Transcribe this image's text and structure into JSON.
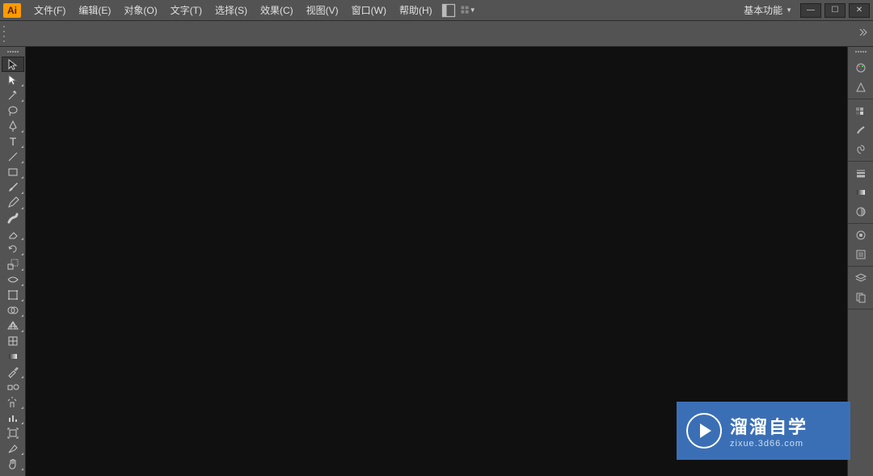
{
  "app": {
    "logo": "Ai"
  },
  "menu": {
    "file": "文件(F)",
    "edit": "编辑(E)",
    "object": "对象(O)",
    "type": "文字(T)",
    "select": "选择(S)",
    "effect": "效果(C)",
    "view": "视图(V)",
    "window": "窗口(W)",
    "help": "帮助(H)"
  },
  "workspace": {
    "label": "基本功能"
  },
  "window_controls": {
    "minimize": "—",
    "maximize": "☐",
    "close": "✕"
  },
  "tools": [
    {
      "name": "selection-tool",
      "selected": true,
      "flyout": false
    },
    {
      "name": "direct-selection-tool",
      "selected": false,
      "flyout": true
    },
    {
      "name": "magic-wand-tool",
      "selected": false,
      "flyout": true
    },
    {
      "name": "lasso-tool",
      "selected": false,
      "flyout": false
    },
    {
      "name": "pen-tool",
      "selected": false,
      "flyout": true
    },
    {
      "name": "type-tool",
      "selected": false,
      "flyout": true
    },
    {
      "name": "line-segment-tool",
      "selected": false,
      "flyout": true
    },
    {
      "name": "rectangle-tool",
      "selected": false,
      "flyout": true
    },
    {
      "name": "paintbrush-tool",
      "selected": false,
      "flyout": true
    },
    {
      "name": "pencil-tool",
      "selected": false,
      "flyout": true
    },
    {
      "name": "blob-brush-tool",
      "selected": false,
      "flyout": false
    },
    {
      "name": "eraser-tool",
      "selected": false,
      "flyout": true
    },
    {
      "name": "rotate-tool",
      "selected": false,
      "flyout": true
    },
    {
      "name": "scale-tool",
      "selected": false,
      "flyout": true
    },
    {
      "name": "width-tool",
      "selected": false,
      "flyout": true
    },
    {
      "name": "free-transform-tool",
      "selected": false,
      "flyout": true
    },
    {
      "name": "shape-builder-tool",
      "selected": false,
      "flyout": true
    },
    {
      "name": "perspective-grid-tool",
      "selected": false,
      "flyout": true
    },
    {
      "name": "mesh-tool",
      "selected": false,
      "flyout": false
    },
    {
      "name": "gradient-tool",
      "selected": false,
      "flyout": false
    },
    {
      "name": "eyedropper-tool",
      "selected": false,
      "flyout": true
    },
    {
      "name": "blend-tool",
      "selected": false,
      "flyout": false
    },
    {
      "name": "symbol-sprayer-tool",
      "selected": false,
      "flyout": true
    },
    {
      "name": "column-graph-tool",
      "selected": false,
      "flyout": true
    },
    {
      "name": "artboard-tool",
      "selected": false,
      "flyout": false
    },
    {
      "name": "slice-tool",
      "selected": false,
      "flyout": true
    },
    {
      "name": "hand-tool",
      "selected": false,
      "flyout": true
    }
  ],
  "right_panels_col1": [
    {
      "group": [
        "color-panel",
        "color-guide-panel"
      ]
    },
    {
      "group": [
        "swatches-panel",
        "brushes-panel",
        "symbols-panel"
      ]
    },
    {
      "group": [
        "stroke-panel",
        "gradient-panel",
        "transparency-panel"
      ]
    },
    {
      "group": [
        "appearance-panel",
        "graphic-styles-panel"
      ]
    },
    {
      "group": [
        "layers-panel",
        "artboards-panel"
      ]
    }
  ],
  "watermark": {
    "main": "溜溜自学",
    "sub": "zixue.3d66.com"
  }
}
